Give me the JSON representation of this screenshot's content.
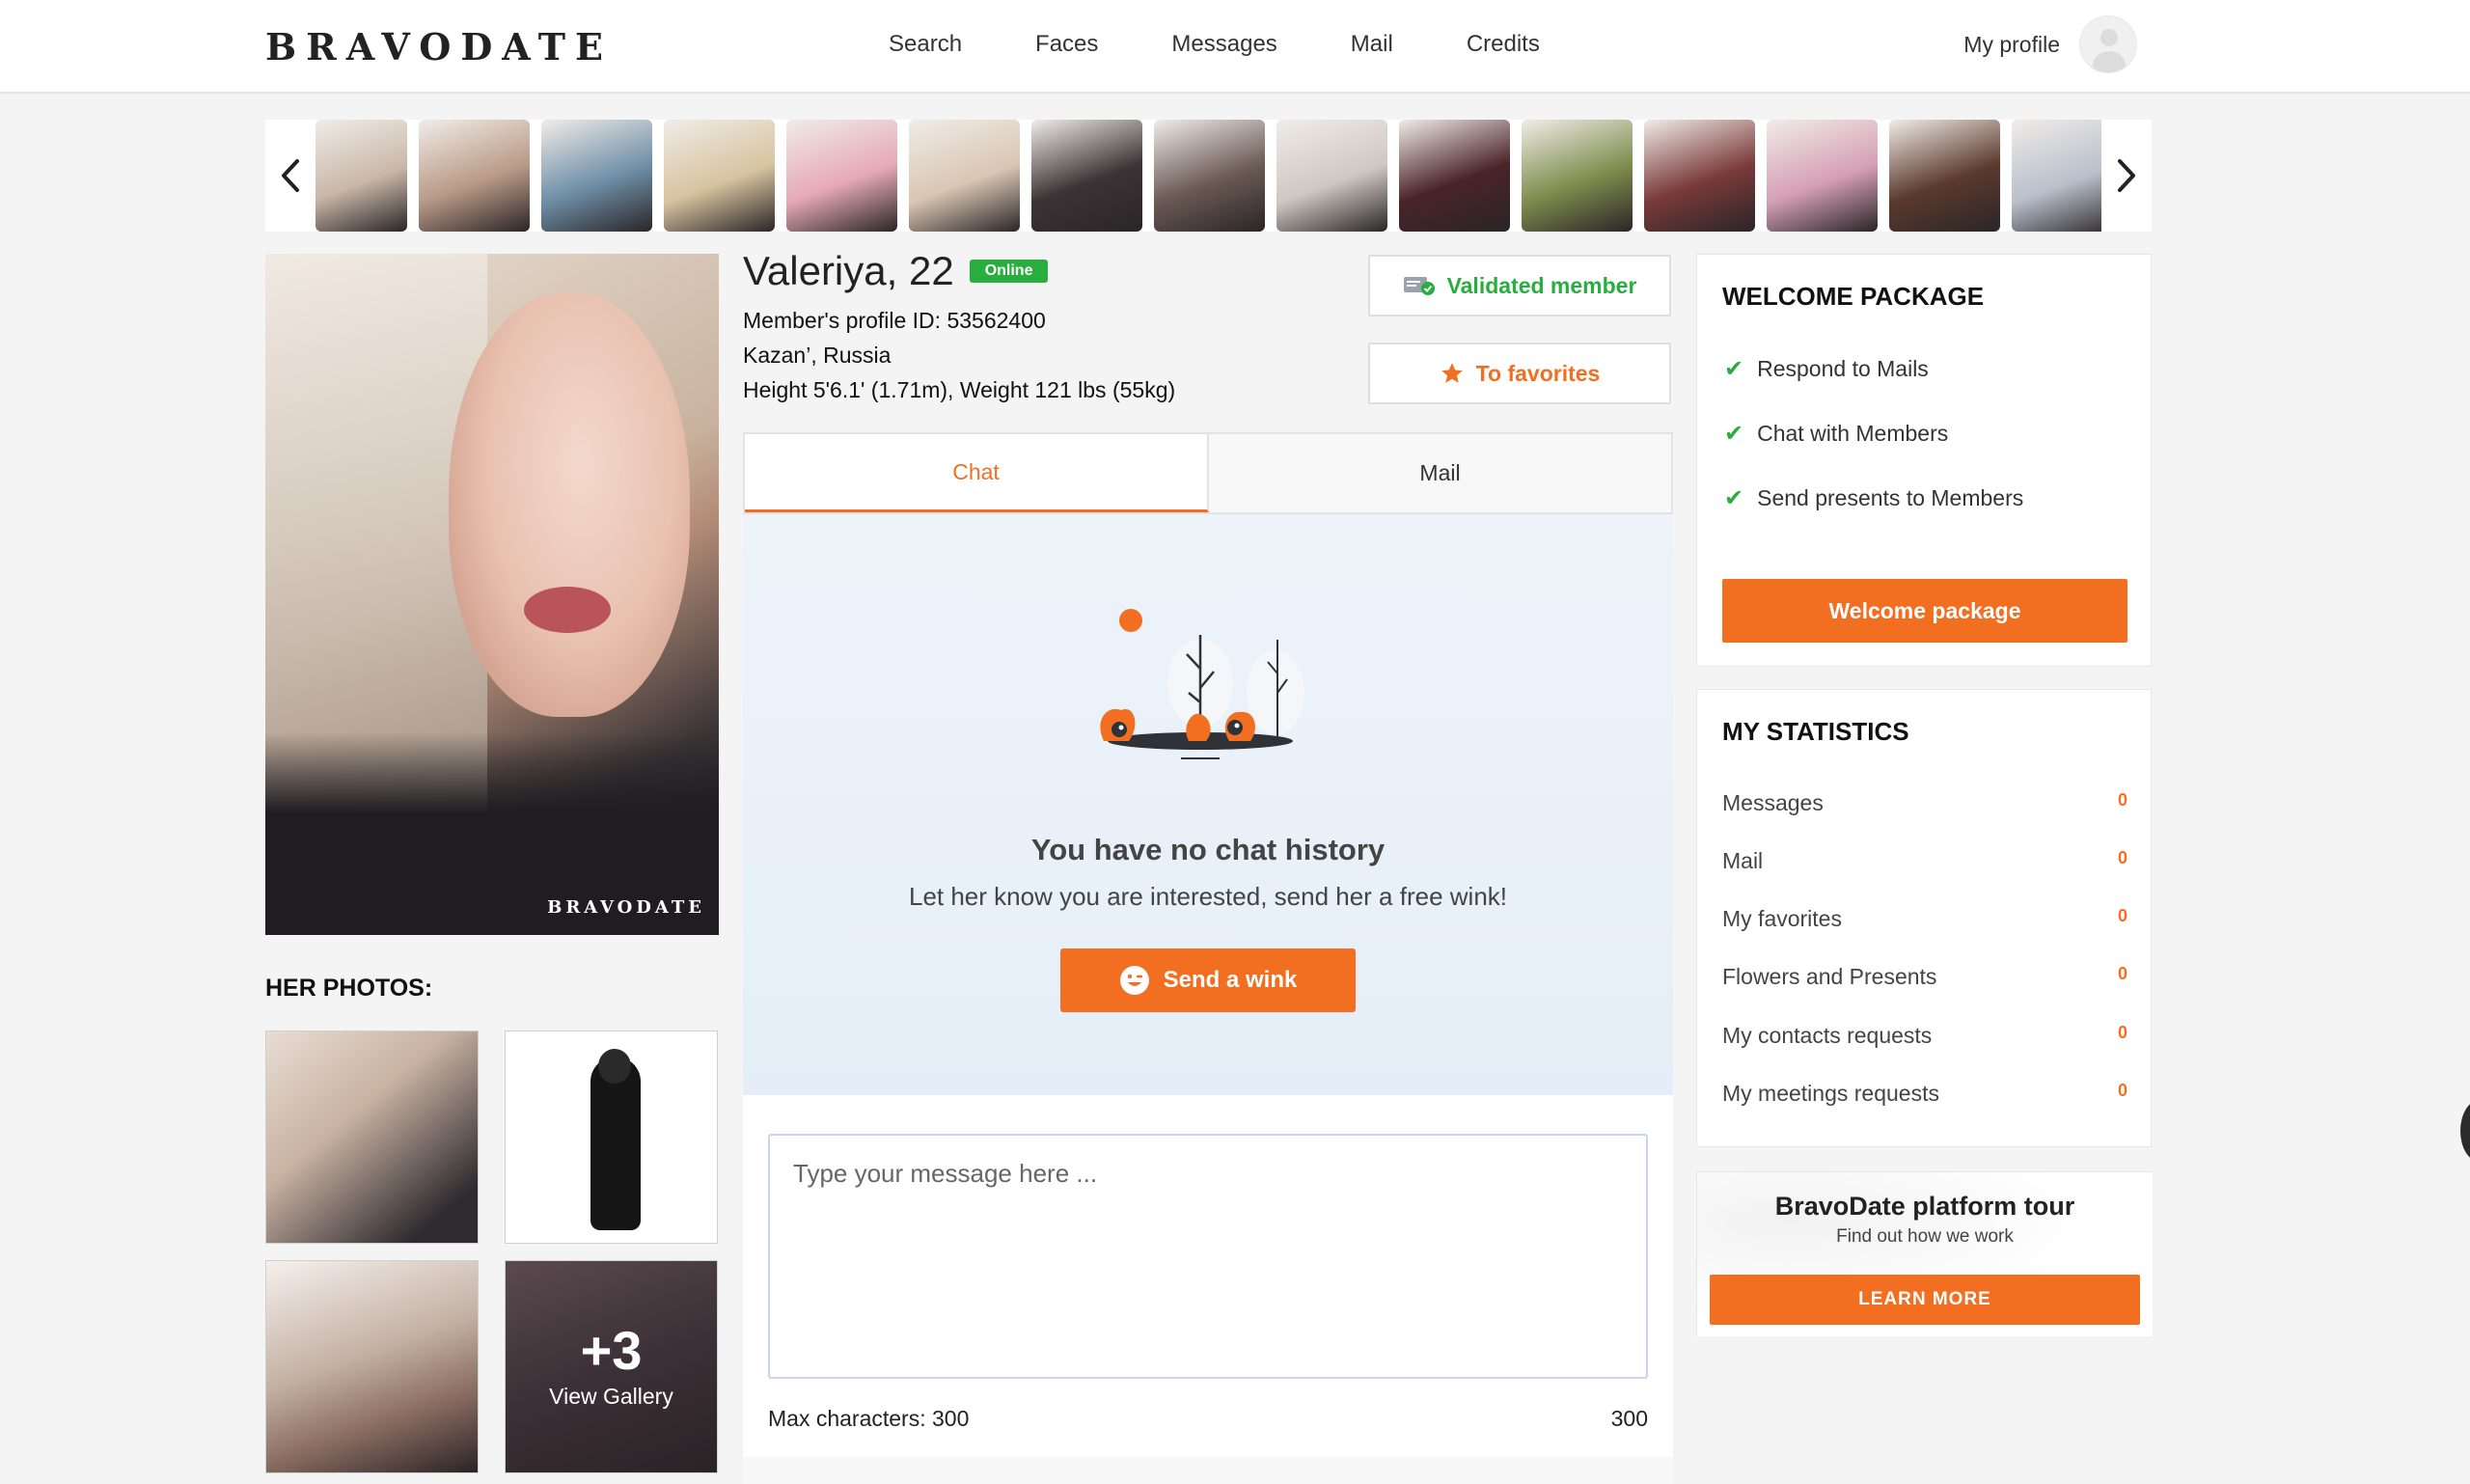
{
  "header": {
    "logo": "BRAVODATE",
    "nav": [
      "Search",
      "Faces",
      "Messages",
      "Mail",
      "Credits"
    ],
    "profile_label": "My profile"
  },
  "carousel": {
    "thumb_colors": [
      "#c9b7a8",
      "#b99a86",
      "#6f8fa8",
      "#d7c39f",
      "#e6a9b5",
      "#d9c6b3",
      "#3b3436",
      "#6b5a55",
      "#cfc8c2",
      "#4a2329",
      "#7f8d4e",
      "#7a3a3a",
      "#d59fb4",
      "#5b3a2d",
      "#b9bfcb"
    ]
  },
  "profile": {
    "name": "Valeriya, 22",
    "status": "Online",
    "profile_id": "Member's profile ID: 53562400",
    "location": "Kazan’, Russia",
    "physical": "Height 5'6.1' (1.71m), Weight 121 lbs (55kg)",
    "validated_label": "Validated member",
    "favorites_label": "To favorites",
    "photo_watermark": "BRAVODATE"
  },
  "photos": {
    "title": "HER PHOTOS:",
    "more_count": "+3",
    "gallery_label": "View Gallery"
  },
  "tabs": {
    "chat": "Chat",
    "mail": "Mail"
  },
  "chat": {
    "empty_title": "You have no chat history",
    "empty_sub": "Let her know you are interested, send her a free wink!",
    "wink_label": "Send a wink",
    "placeholder": "Type your message here ...",
    "max_chars_label": "Max characters: 300",
    "char_count": "300"
  },
  "welcome": {
    "title": "WELCOME PACKAGE",
    "items": [
      "Respond to Mails",
      "Chat with Members",
      "Send presents to Members"
    ],
    "button": "Welcome package"
  },
  "stats": {
    "title": "MY STATISTICS",
    "rows": [
      {
        "label": "Messages",
        "value": "0"
      },
      {
        "label": "Mail",
        "value": "0"
      },
      {
        "label": "My favorites",
        "value": "0"
      },
      {
        "label": "Flowers and Presents",
        "value": "0"
      },
      {
        "label": "My contacts requests",
        "value": "0"
      },
      {
        "label": "My meetings requests",
        "value": "0"
      }
    ]
  },
  "tour": {
    "title": "BravoDate platform tour",
    "subtitle": "Find out how we work",
    "button": "LEARN MORE"
  },
  "colors": {
    "accent": "#f26f21",
    "online": "#27ae3e"
  }
}
